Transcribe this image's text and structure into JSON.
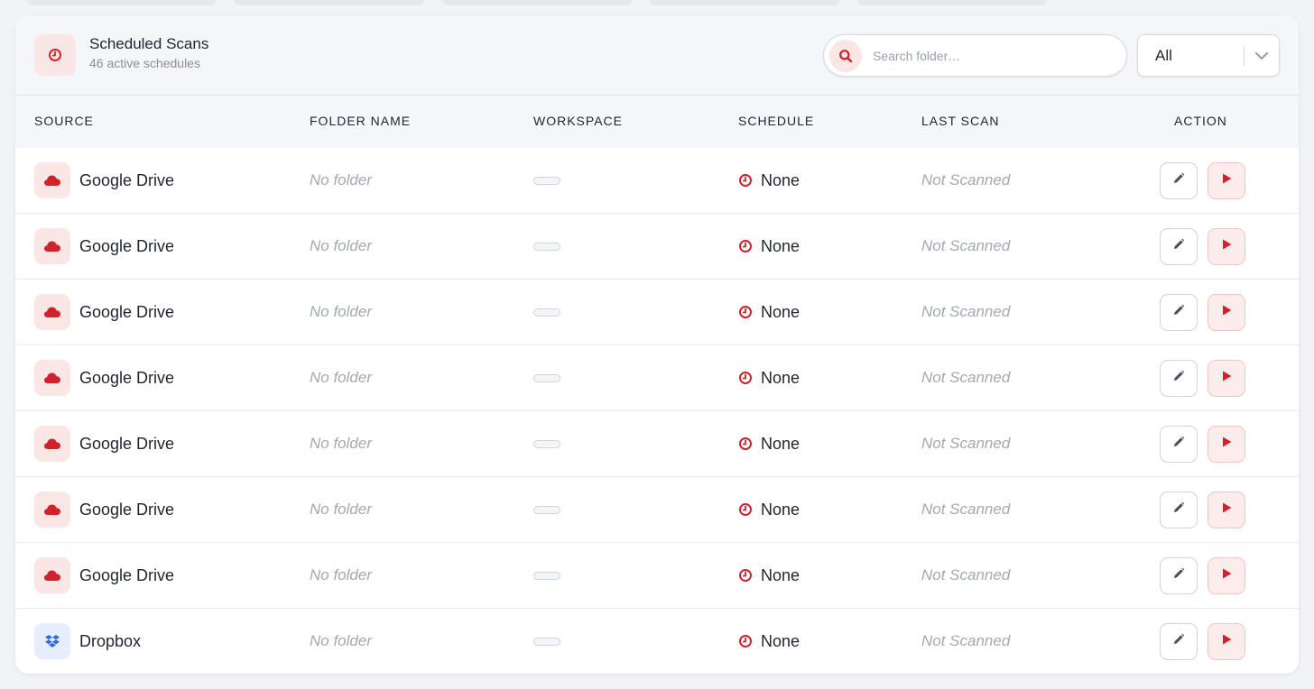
{
  "colors": {
    "accent": "#d0222c",
    "accent_bg": "#fbe6e6",
    "dropbox": "#2f6de1",
    "dropbox_bg": "#e6edfb",
    "muted": "#a3a8b2"
  },
  "header": {
    "title": "Scheduled Scans",
    "subtitle": "46 active schedules",
    "icon": "clock-icon"
  },
  "search": {
    "placeholder": "Search folder…",
    "value": ""
  },
  "filter": {
    "selected": "All"
  },
  "table": {
    "columns": [
      "SOURCE",
      "FOLDER NAME",
      "WORKSPACE",
      "SCHEDULE",
      "LAST SCAN",
      "ACTION"
    ],
    "rows": [
      {
        "source": "Google Drive",
        "icon": "cloud-icon",
        "folder": "No folder",
        "schedule": "None",
        "last_scan": "Not Scanned"
      },
      {
        "source": "Google Drive",
        "icon": "cloud-icon",
        "folder": "No folder",
        "schedule": "None",
        "last_scan": "Not Scanned"
      },
      {
        "source": "Google Drive",
        "icon": "cloud-icon",
        "folder": "No folder",
        "schedule": "None",
        "last_scan": "Not Scanned"
      },
      {
        "source": "Google Drive",
        "icon": "cloud-icon",
        "folder": "No folder",
        "schedule": "None",
        "last_scan": "Not Scanned"
      },
      {
        "source": "Google Drive",
        "icon": "cloud-icon",
        "folder": "No folder",
        "schedule": "None",
        "last_scan": "Not Scanned"
      },
      {
        "source": "Google Drive",
        "icon": "cloud-icon",
        "folder": "No folder",
        "schedule": "None",
        "last_scan": "Not Scanned"
      },
      {
        "source": "Google Drive",
        "icon": "cloud-icon",
        "folder": "No folder",
        "schedule": "None",
        "last_scan": "Not Scanned"
      },
      {
        "source": "Dropbox",
        "icon": "dropbox-icon",
        "folder": "No folder",
        "schedule": "None",
        "last_scan": "Not Scanned"
      }
    ]
  }
}
